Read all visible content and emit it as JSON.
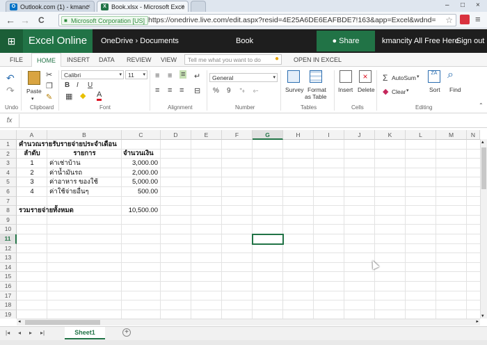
{
  "browser": {
    "tabs": [
      {
        "title": "Outlook.com (1) - kmanc",
        "icon": "O",
        "icon_color": "#0072c6",
        "active": false
      },
      {
        "title": "Book.xlsx - Microsoft Exce",
        "icon": "X",
        "icon_color": "#217346",
        "active": true
      }
    ],
    "tab_close": "×",
    "window_controls": {
      "min": "–",
      "max": "□",
      "close": "×"
    },
    "nav": {
      "back": "←",
      "forward": "→",
      "reload": "C"
    },
    "security_label": "Microsoft Corporation [US]",
    "url": "https://onedrive.live.com/edit.aspx?resid=4E25A6DE6EAFBDE7!163&app=Excel&wdnd=",
    "star": "☆",
    "menu": "≡"
  },
  "app": {
    "waffle": "⊞",
    "brand": "Excel Online",
    "breadcrumb_root": "OneDrive",
    "breadcrumb_sep": "›",
    "breadcrumb_folder": "Documents",
    "doc_title": "Book",
    "share_label": "Share",
    "user": "kmancity All Free Here",
    "signout": "Sign out"
  },
  "ribbon_tabs": [
    "FILE",
    "HOME",
    "INSERT",
    "DATA",
    "REVIEW",
    "VIEW"
  ],
  "active_tab": "HOME",
  "tellme_placeholder": "Tell me what you want to do",
  "open_in_excel": "OPEN IN EXCEL",
  "ribbon": {
    "groups": [
      "Undo",
      "Clipboard",
      "Font",
      "Alignment",
      "Number",
      "Tables",
      "Cells",
      "Editing"
    ],
    "paste": "Paste",
    "font_name": "Calibri",
    "font_size": "11",
    "bold": "B",
    "italic": "I",
    "underline": "U",
    "number_format": "General",
    "percent": "%",
    "comma": "9",
    "survey": "Survey",
    "format_table_1": "Format",
    "format_table_2": "as Table",
    "insert": "Insert",
    "delete": "Delete",
    "autosum": "AutoSum",
    "clear": "Clear",
    "sort": "Sort",
    "find": "Find"
  },
  "formula_bar": {
    "fx": "fx",
    "value": ""
  },
  "columns": [
    "A",
    "B",
    "C",
    "D",
    "E",
    "F",
    "G",
    "H",
    "I",
    "J",
    "K",
    "L",
    "M",
    "N"
  ],
  "selected_column": "G",
  "rows": [
    "1",
    "2",
    "3",
    "4",
    "5",
    "6",
    "7",
    "8",
    "9",
    "10",
    "11",
    "12",
    "13",
    "14",
    "15",
    "16",
    "17",
    "18",
    "19"
  ],
  "selected_row": "11",
  "sheet": {
    "title": "คำนวณรายรับรายจ่ายประจำเดือน",
    "headers": [
      "ลำดับ",
      "รายการ",
      "จำนวนเงิน"
    ],
    "items": [
      {
        "no": "1",
        "name": "ค่าเช่าบ้าน",
        "amount": "3,000.00"
      },
      {
        "no": "2",
        "name": "ค่าน้ำมันรถ",
        "amount": "2,000.00"
      },
      {
        "no": "3",
        "name": "ค่าอาหาร ของใช้",
        "amount": "5,000.00"
      },
      {
        "no": "4",
        "name": "ค่าใช้จ่ายอื่นๆ",
        "amount": "500.00"
      }
    ],
    "total_label": "รวมรายจ่ายทั้งหมด",
    "total_value": "10,500.00"
  },
  "sheet_tabs": [
    "Sheet1"
  ],
  "add_sheet": "+"
}
